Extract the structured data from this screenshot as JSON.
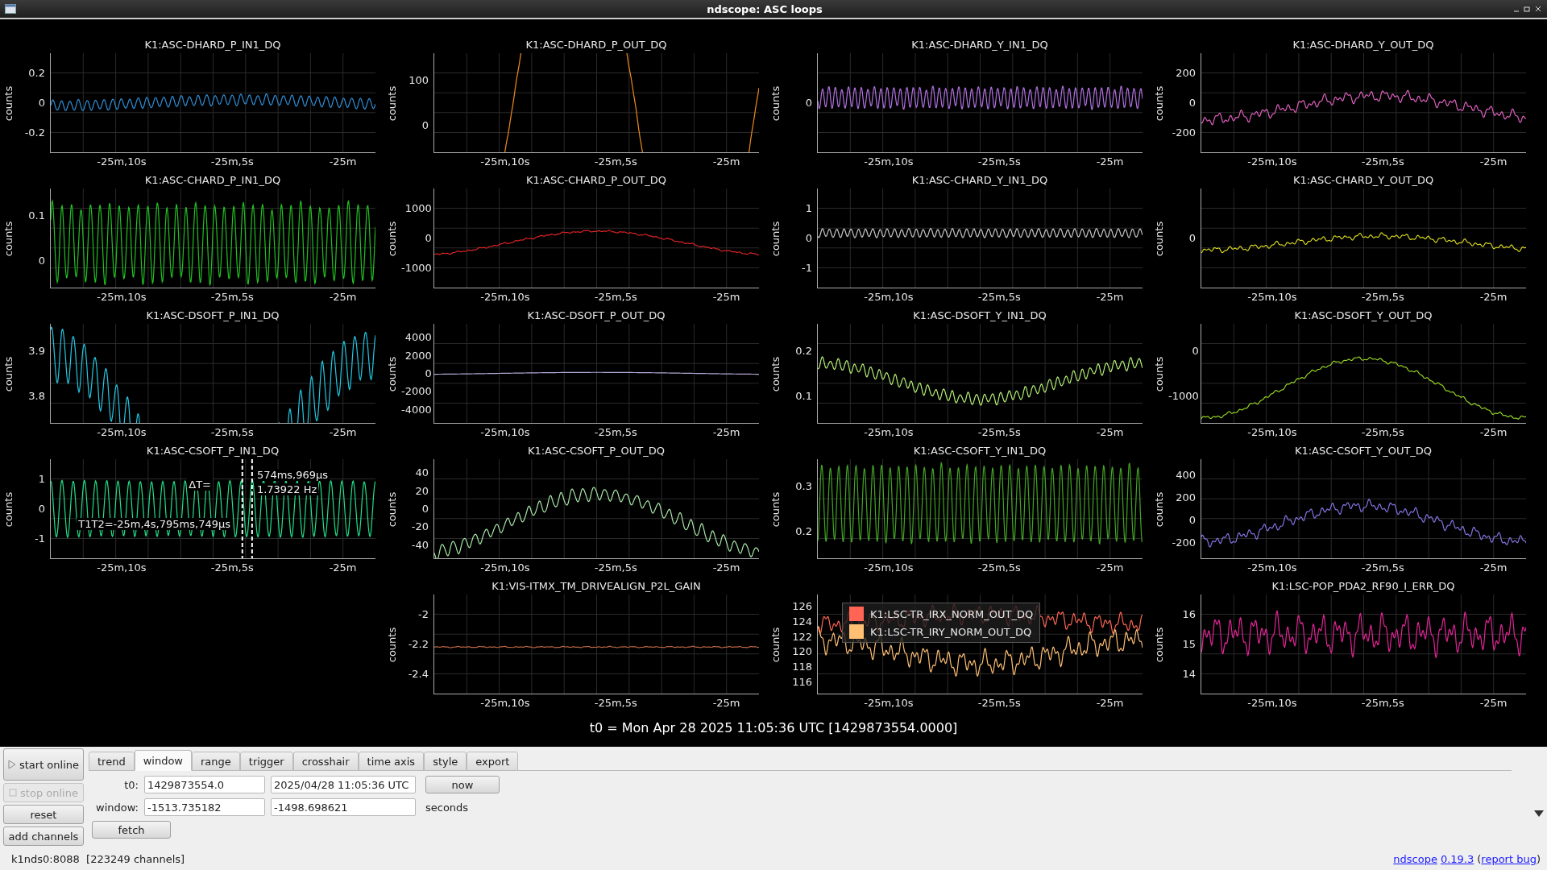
{
  "window": {
    "title": "ndscope: ASC loops"
  },
  "plot_rows": [
    [
      {
        "title": "K1:ASC-DHARD_P_IN1_DQ",
        "ylabel": "counts",
        "yticks": [
          "0.2",
          "0",
          "-0.2"
        ],
        "xticks": [
          "-25m,10s",
          "-25m,5s",
          "-25m"
        ],
        "traces": [
          {
            "color": "#2f8fd8"
          }
        ]
      },
      {
        "title": "K1:ASC-DHARD_P_OUT_DQ",
        "ylabel": "counts",
        "yticks": [
          "100",
          "0"
        ],
        "xticks": [
          "-25m,10s",
          "-25m,5s",
          "-25m"
        ],
        "traces": [
          {
            "color": "#f08a1c"
          }
        ]
      },
      {
        "title": "K1:ASC-DHARD_Y_IN1_DQ",
        "ylabel": "counts",
        "yticks": [
          "0"
        ],
        "xticks": [
          "-25m,10s",
          "-25m,5s",
          "-25m"
        ],
        "traces": [
          {
            "color": "#b070e0"
          }
        ]
      },
      {
        "title": "K1:ASC-DHARD_Y_OUT_DQ",
        "ylabel": "counts",
        "yticks": [
          "200",
          "0",
          "-200"
        ],
        "xticks": [
          "-25m,10s",
          "-25m,5s",
          "-25m"
        ],
        "traces": [
          {
            "color": "#e060c0"
          }
        ]
      }
    ],
    [
      {
        "title": "K1:ASC-CHARD_P_IN1_DQ",
        "ylabel": "counts",
        "yticks": [
          "0.1",
          "0"
        ],
        "xticks": [
          "-25m,10s",
          "-25m,5s",
          "-25m"
        ],
        "traces": [
          {
            "color": "#22c022"
          }
        ]
      },
      {
        "title": "K1:ASC-CHARD_P_OUT_DQ",
        "ylabel": "counts",
        "yticks": [
          "1000",
          "0",
          "-1000"
        ],
        "xticks": [
          "-25m,10s",
          "-25m,5s",
          "-25m"
        ],
        "traces": [
          {
            "color": "#e02424"
          }
        ]
      },
      {
        "title": "K1:ASC-CHARD_Y_IN1_DQ",
        "ylabel": "counts",
        "yticks": [
          "1",
          "0",
          "-1"
        ],
        "xticks": [
          "-25m,10s",
          "-25m,5s",
          "-25m"
        ],
        "traces": [
          {
            "color": "#c8c8c8"
          }
        ]
      },
      {
        "title": "K1:ASC-CHARD_Y_OUT_DQ",
        "ylabel": "counts",
        "yticks": [
          "0"
        ],
        "xticks": [
          "-25m,10s",
          "-25m,5s",
          "-25m"
        ],
        "traces": [
          {
            "color": "#d4d420"
          }
        ]
      }
    ],
    [
      {
        "title": "K1:ASC-DSOFT_P_IN1_DQ",
        "ylabel": "counts",
        "yticks": [
          "3.9",
          "3.8"
        ],
        "xticks": [
          "-25m,10s",
          "-25m,5s",
          "-25m"
        ],
        "traces": [
          {
            "color": "#22c8e4"
          }
        ]
      },
      {
        "title": "K1:ASC-DSOFT_P_OUT_DQ",
        "ylabel": "counts",
        "yticks": [
          "4000",
          "2000",
          "0",
          "-2000",
          "-4000"
        ],
        "xticks": [
          "-25m,10s",
          "-25m,5s",
          "-25m"
        ],
        "traces": [
          {
            "color": "#b4a8d4"
          }
        ]
      },
      {
        "title": "K1:ASC-DSOFT_Y_IN1_DQ",
        "ylabel": "counts",
        "yticks": [
          "0.2",
          "0.1"
        ],
        "xticks": [
          "-25m,10s",
          "-25m,5s",
          "-25m"
        ],
        "traces": [
          {
            "color": "#b4f074"
          }
        ]
      },
      {
        "title": "K1:ASC-DSOFT_Y_OUT_DQ",
        "ylabel": "counts",
        "yticks": [
          "0",
          "-1000"
        ],
        "xticks": [
          "-25m,10s",
          "-25m,5s",
          "-25m"
        ],
        "traces": [
          {
            "color": "#94d424"
          }
        ]
      }
    ],
    [
      {
        "title": "K1:ASC-CSOFT_P_IN1_DQ",
        "ylabel": "counts",
        "yticks": [
          "1",
          "0",
          "-1"
        ],
        "xticks": [
          "-25m,10s",
          "-25m,5s",
          "-25m"
        ],
        "traces": [
          {
            "color": "#22e088"
          }
        ],
        "cursors": {
          "delta_label": "ΔT=",
          "delta_time": "574ms,969μs",
          "delta_freq": "1.73922 Hz",
          "t_label": "T1T2=-25m,4s,795ms,749μs"
        }
      },
      {
        "title": "K1:ASC-CSOFT_P_OUT_DQ",
        "ylabel": "counts",
        "yticks": [
          "40",
          "20",
          "0",
          "-20",
          "-40"
        ],
        "xticks": [
          "-25m,10s",
          "-25m,5s",
          "-25m"
        ],
        "traces": [
          {
            "color": "#a8e8a8"
          }
        ]
      },
      {
        "title": "K1:ASC-CSOFT_Y_IN1_DQ",
        "ylabel": "counts",
        "yticks": [
          "0.3",
          "0.2"
        ],
        "xticks": [
          "-25m,10s",
          "-25m,5s",
          "-25m"
        ],
        "traces": [
          {
            "color": "#44a424"
          }
        ]
      },
      {
        "title": "K1:ASC-CSOFT_Y_OUT_DQ",
        "ylabel": "counts",
        "yticks": [
          "400",
          "200",
          "0",
          "-200"
        ],
        "xticks": [
          "-25m,10s",
          "-25m,5s",
          "-25m"
        ],
        "traces": [
          {
            "color": "#8474e4"
          }
        ]
      }
    ],
    [
      {
        "title": "K1:VIS-ITMX_TM_DRIVEALIGN_P2L_GAIN",
        "ylabel": "counts",
        "yticks": [
          "-2",
          "-2.2",
          "-2.4"
        ],
        "xticks": [
          "-25m,10s",
          "-25m,5s",
          "-25m"
        ],
        "traces": [
          {
            "color": "#c06844"
          }
        ]
      },
      {
        "ylabel": "counts",
        "yticks": [
          "126",
          "124",
          "122",
          "120",
          "118",
          "116"
        ],
        "xticks": [
          "-25m,10s",
          "-25m,5s",
          "-25m"
        ],
        "traces": [
          {
            "name": "K1:LSC-TR_IRX_NORM_OUT_DQ",
            "color": "#ff6454"
          },
          {
            "name": "K1:LSC-TR_IRY_NORM_OUT_DQ",
            "color": "#ffc074"
          }
        ]
      },
      {
        "title": "K1:LSC-POP_PDA2_RF90_I_ERR_DQ",
        "ylabel": "counts",
        "yticks": [
          "16",
          "15",
          "14"
        ],
        "xticks": [
          "-25m,10s",
          "-25m,5s",
          "-25m"
        ],
        "traces": [
          {
            "color": "#e42498"
          }
        ]
      }
    ]
  ],
  "t0_caption": "t0 = Mon Apr 28 2025 11:05:36 UTC [1429873554.0000]",
  "side_buttons": [
    {
      "label": "start online",
      "kind": "play",
      "disabled": false
    },
    {
      "label": "stop online",
      "kind": "stop",
      "disabled": true
    },
    {
      "label": "reset",
      "kind": "plain",
      "disabled": false
    },
    {
      "label": "add channels",
      "kind": "plain",
      "disabled": false
    }
  ],
  "tabs": [
    {
      "label": "trend",
      "selected": false
    },
    {
      "label": "window",
      "selected": true
    },
    {
      "label": "range",
      "selected": false
    },
    {
      "label": "trigger",
      "selected": false
    },
    {
      "label": "crosshair",
      "selected": false
    },
    {
      "label": "time axis",
      "selected": false
    },
    {
      "label": "style",
      "selected": false
    },
    {
      "label": "export",
      "selected": false
    }
  ],
  "t0_row": {
    "label": "t0:",
    "gps": "1429873554.0",
    "utc": "2025/04/28 11:05:36 UTC",
    "button": "now"
  },
  "window_row": {
    "label": "window:",
    "start": "-1513.735182",
    "end": "-1498.698621",
    "unit": "seconds"
  },
  "fetch_button": "fetch",
  "status": {
    "server": "k1nds0:8088  [223249 channels]",
    "app_link": "ndscope",
    "version_link": "0.19.3",
    "open_paren": "(",
    "bug_link": "report bug",
    "close_paren": ")"
  }
}
